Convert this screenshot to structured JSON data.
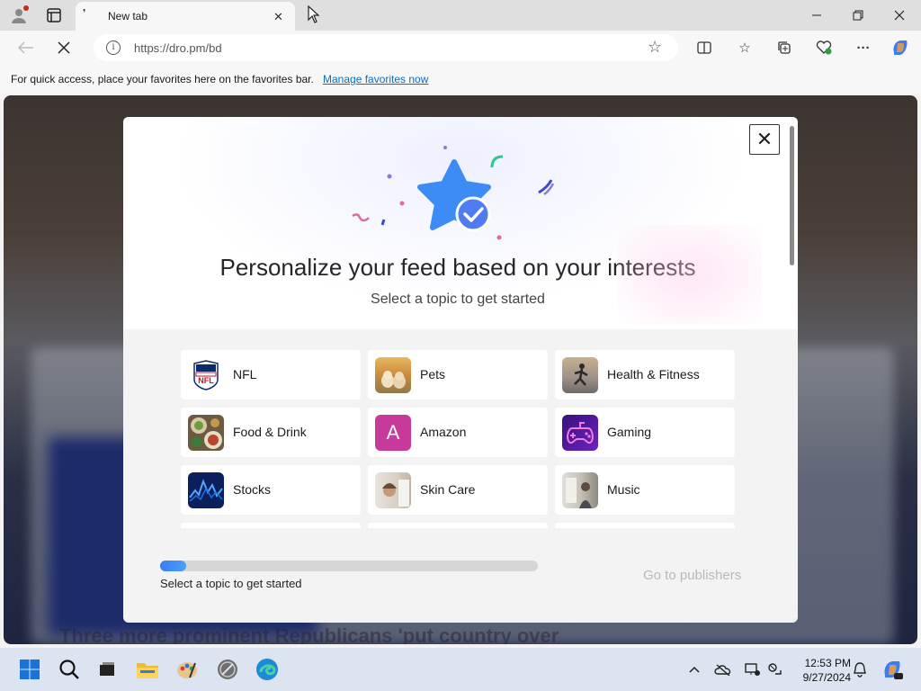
{
  "browser": {
    "tab": {
      "title": "New tab"
    },
    "address": {
      "url": "https://dro.pm/bd"
    },
    "favorites_bar": {
      "message": "For quick access, place your favorites here on the favorites bar.",
      "link": "Manage favorites now"
    }
  },
  "page": {
    "headline": "Three more prominent Republicans 'put country over"
  },
  "modal": {
    "title": "Personalize your feed based on your interests",
    "subtitle": "Select a topic to get started",
    "close_symbol": "✕",
    "topics": [
      {
        "label": "NFL",
        "icon": "nfl-shield-icon"
      },
      {
        "label": "Pets",
        "icon": "pets-photo"
      },
      {
        "label": "Health & Fitness",
        "icon": "fitness-photo"
      },
      {
        "label": "Food & Drink",
        "icon": "food-photo"
      },
      {
        "label": "Amazon",
        "icon": "amazon-letter-icon",
        "letter": "A"
      },
      {
        "label": "Gaming",
        "icon": "gamepad-icon"
      },
      {
        "label": "Stocks",
        "icon": "stocks-chart-photo"
      },
      {
        "label": "Skin Care",
        "icon": "skincare-photo"
      },
      {
        "label": "Music",
        "icon": "music-photo"
      }
    ],
    "progress": {
      "fraction": 0.07,
      "label": "Select a topic to get started"
    },
    "go_button": "Go to publishers"
  },
  "taskbar": {
    "clock_time": "12:53 PM",
    "clock_date": "9/27/2024"
  },
  "colors": {
    "accent": "#0f6cbd",
    "amazon_tile": "#c73a9c",
    "gaming_tile": "#5a1fa8",
    "progress": "#3b7cf0"
  }
}
